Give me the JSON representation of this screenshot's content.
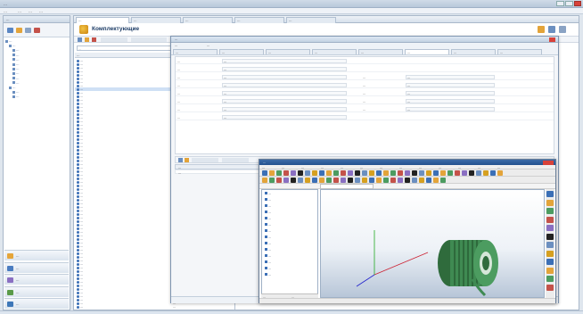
{
  "app": {
    "title": "…"
  },
  "menubar": [
    "…",
    "…",
    "…",
    "…"
  ],
  "leftnav": {
    "header": "…",
    "tree": [
      {
        "label": "…",
        "depth": 0
      },
      {
        "label": "…",
        "depth": 1
      },
      {
        "label": "…",
        "depth": 2
      },
      {
        "label": "…",
        "depth": 2
      },
      {
        "label": "…",
        "depth": 2
      },
      {
        "label": "…",
        "depth": 2
      },
      {
        "label": "…",
        "depth": 2
      },
      {
        "label": "…",
        "depth": 2
      },
      {
        "label": "…",
        "depth": 2
      },
      {
        "label": "…",
        "depth": 2
      },
      {
        "label": "…",
        "depth": 1
      },
      {
        "label": "…",
        "depth": 2
      },
      {
        "label": "…",
        "depth": 2
      }
    ],
    "big_buttons": [
      {
        "label": "…",
        "icon": "folder-icon",
        "color": "#e5a53a"
      },
      {
        "label": "…",
        "icon": "document-icon",
        "color": "#4a7cc0"
      },
      {
        "label": "…",
        "icon": "stamp-icon",
        "color": "#8a6fc2"
      },
      {
        "label": "…",
        "icon": "gear-icon",
        "color": "#5a9a48"
      },
      {
        "label": "…",
        "icon": "list-icon",
        "color": "#3e77b8"
      }
    ]
  },
  "main": {
    "tabs": [
      {
        "label": "…",
        "active": true
      },
      {
        "label": "…"
      },
      {
        "label": "…"
      },
      {
        "label": "…"
      },
      {
        "label": "…"
      }
    ],
    "page_title": "Комплектующие",
    "list": {
      "search_placeholder": "…",
      "col_name": "…",
      "col_value": "…",
      "rows": [
        {
          "name": "…",
          "value": "…"
        },
        {
          "name": "…",
          "value": "…"
        },
        {
          "name": "…",
          "value": "…"
        },
        {
          "name": "…",
          "value": "…"
        },
        {
          "name": "…",
          "value": "…"
        },
        {
          "name": "…",
          "value": "…"
        },
        {
          "name": "…",
          "value": "…"
        },
        {
          "name": "…",
          "value": "…"
        },
        {
          "name": "…",
          "value": "…",
          "selected": true
        },
        {
          "name": "…",
          "value": "…"
        },
        {
          "name": "…",
          "value": "…"
        },
        {
          "name": "…",
          "value": "…"
        },
        {
          "name": "…",
          "value": "…"
        },
        {
          "name": "…",
          "value": "…"
        },
        {
          "name": "…",
          "value": "…"
        },
        {
          "name": "…",
          "value": "…"
        },
        {
          "name": "…",
          "value": "…"
        },
        {
          "name": "…",
          "value": "…"
        },
        {
          "name": "…",
          "value": "…"
        },
        {
          "name": "…",
          "value": "…"
        },
        {
          "name": "…",
          "value": "…"
        },
        {
          "name": "…",
          "value": "…"
        },
        {
          "name": "…",
          "value": "…"
        },
        {
          "name": "…",
          "value": "…"
        },
        {
          "name": "…",
          "value": "…"
        },
        {
          "name": "…",
          "value": "…"
        },
        {
          "name": "…",
          "value": "…"
        },
        {
          "name": "…",
          "value": "…"
        },
        {
          "name": "…",
          "value": "…"
        },
        {
          "name": "…",
          "value": "…"
        },
        {
          "name": "…",
          "value": "…"
        },
        {
          "name": "…",
          "value": "…"
        },
        {
          "name": "…",
          "value": "…"
        },
        {
          "name": "…",
          "value": "…"
        },
        {
          "name": "…",
          "value": "…"
        },
        {
          "name": "…",
          "value": "…"
        },
        {
          "name": "…",
          "value": "…"
        },
        {
          "name": "…",
          "value": "…"
        },
        {
          "name": "…",
          "value": "…"
        },
        {
          "name": "…",
          "value": "…"
        },
        {
          "name": "…",
          "value": "…"
        },
        {
          "name": "…",
          "value": "…"
        },
        {
          "name": "…",
          "value": "…"
        },
        {
          "name": "…",
          "value": "…"
        },
        {
          "name": "…",
          "value": "…"
        },
        {
          "name": "…",
          "value": "…"
        },
        {
          "name": "…",
          "value": "…"
        },
        {
          "name": "…",
          "value": "…"
        },
        {
          "name": "…",
          "value": "…"
        },
        {
          "name": "…",
          "value": "…"
        },
        {
          "name": "…",
          "value": "…"
        },
        {
          "name": "…",
          "value": "…"
        },
        {
          "name": "…",
          "value": "…"
        },
        {
          "name": "…",
          "value": "…"
        },
        {
          "name": "…",
          "value": "…"
        },
        {
          "name": "…",
          "value": "…"
        },
        {
          "name": "…",
          "value": "…"
        },
        {
          "name": "…",
          "value": "…"
        },
        {
          "name": "…",
          "value": "…"
        },
        {
          "name": "…",
          "value": "…"
        },
        {
          "name": "…",
          "value": "…"
        },
        {
          "name": "…",
          "value": "…"
        },
        {
          "name": "…",
          "value": "…"
        },
        {
          "name": "…",
          "value": "…"
        },
        {
          "name": "…",
          "value": "…"
        },
        {
          "name": "…",
          "value": "…"
        },
        {
          "name": "…",
          "value": "…"
        },
        {
          "name": "…",
          "value": "…"
        },
        {
          "name": "…",
          "value": "…"
        },
        {
          "name": "…",
          "value": "…"
        }
      ]
    }
  },
  "doc": {
    "title": "…",
    "tabs_top": [
      "…",
      "…"
    ],
    "tabs": [
      {
        "label": "…"
      },
      {
        "label": "…"
      },
      {
        "label": "…"
      },
      {
        "label": "…"
      },
      {
        "label": "…"
      },
      {
        "label": "…",
        "active": true
      },
      {
        "label": "…"
      },
      {
        "label": "…"
      }
    ],
    "fields": [
      {
        "label": "…",
        "value": "…"
      },
      {
        "label": "…",
        "value": "…"
      },
      {
        "label": "…",
        "value": "…",
        "label2": "…",
        "value2": "…"
      },
      {
        "label": "…",
        "value": "…",
        "label2": "…",
        "value2": "…"
      },
      {
        "label": "…",
        "value": "…",
        "label2": "…",
        "value2": "…"
      },
      {
        "label": "…",
        "value": "…",
        "label2": "…",
        "value2": "…"
      },
      {
        "label": "…",
        "value": "…",
        "label2": "…",
        "value2": "…"
      },
      {
        "label": "…",
        "value": "…"
      }
    ],
    "files_header": [
      "…",
      "…",
      "…",
      "…"
    ],
    "file_row": [
      "…",
      "…",
      "…",
      "…"
    ]
  },
  "cad": {
    "title": "…",
    "menu": [
      "…",
      "…",
      "…",
      "…",
      "…",
      "…",
      "…",
      "…",
      "…",
      "…",
      "…",
      "…",
      "…"
    ],
    "tree": [
      "…",
      "…",
      "…",
      "…",
      "…",
      "…",
      "…",
      "…",
      "…",
      "…",
      "…",
      "…",
      "…",
      "…"
    ],
    "bottom_tabs": [
      "…",
      "…"
    ]
  },
  "colors": {
    "accent": "#24528f",
    "model": "#3f8a52"
  }
}
